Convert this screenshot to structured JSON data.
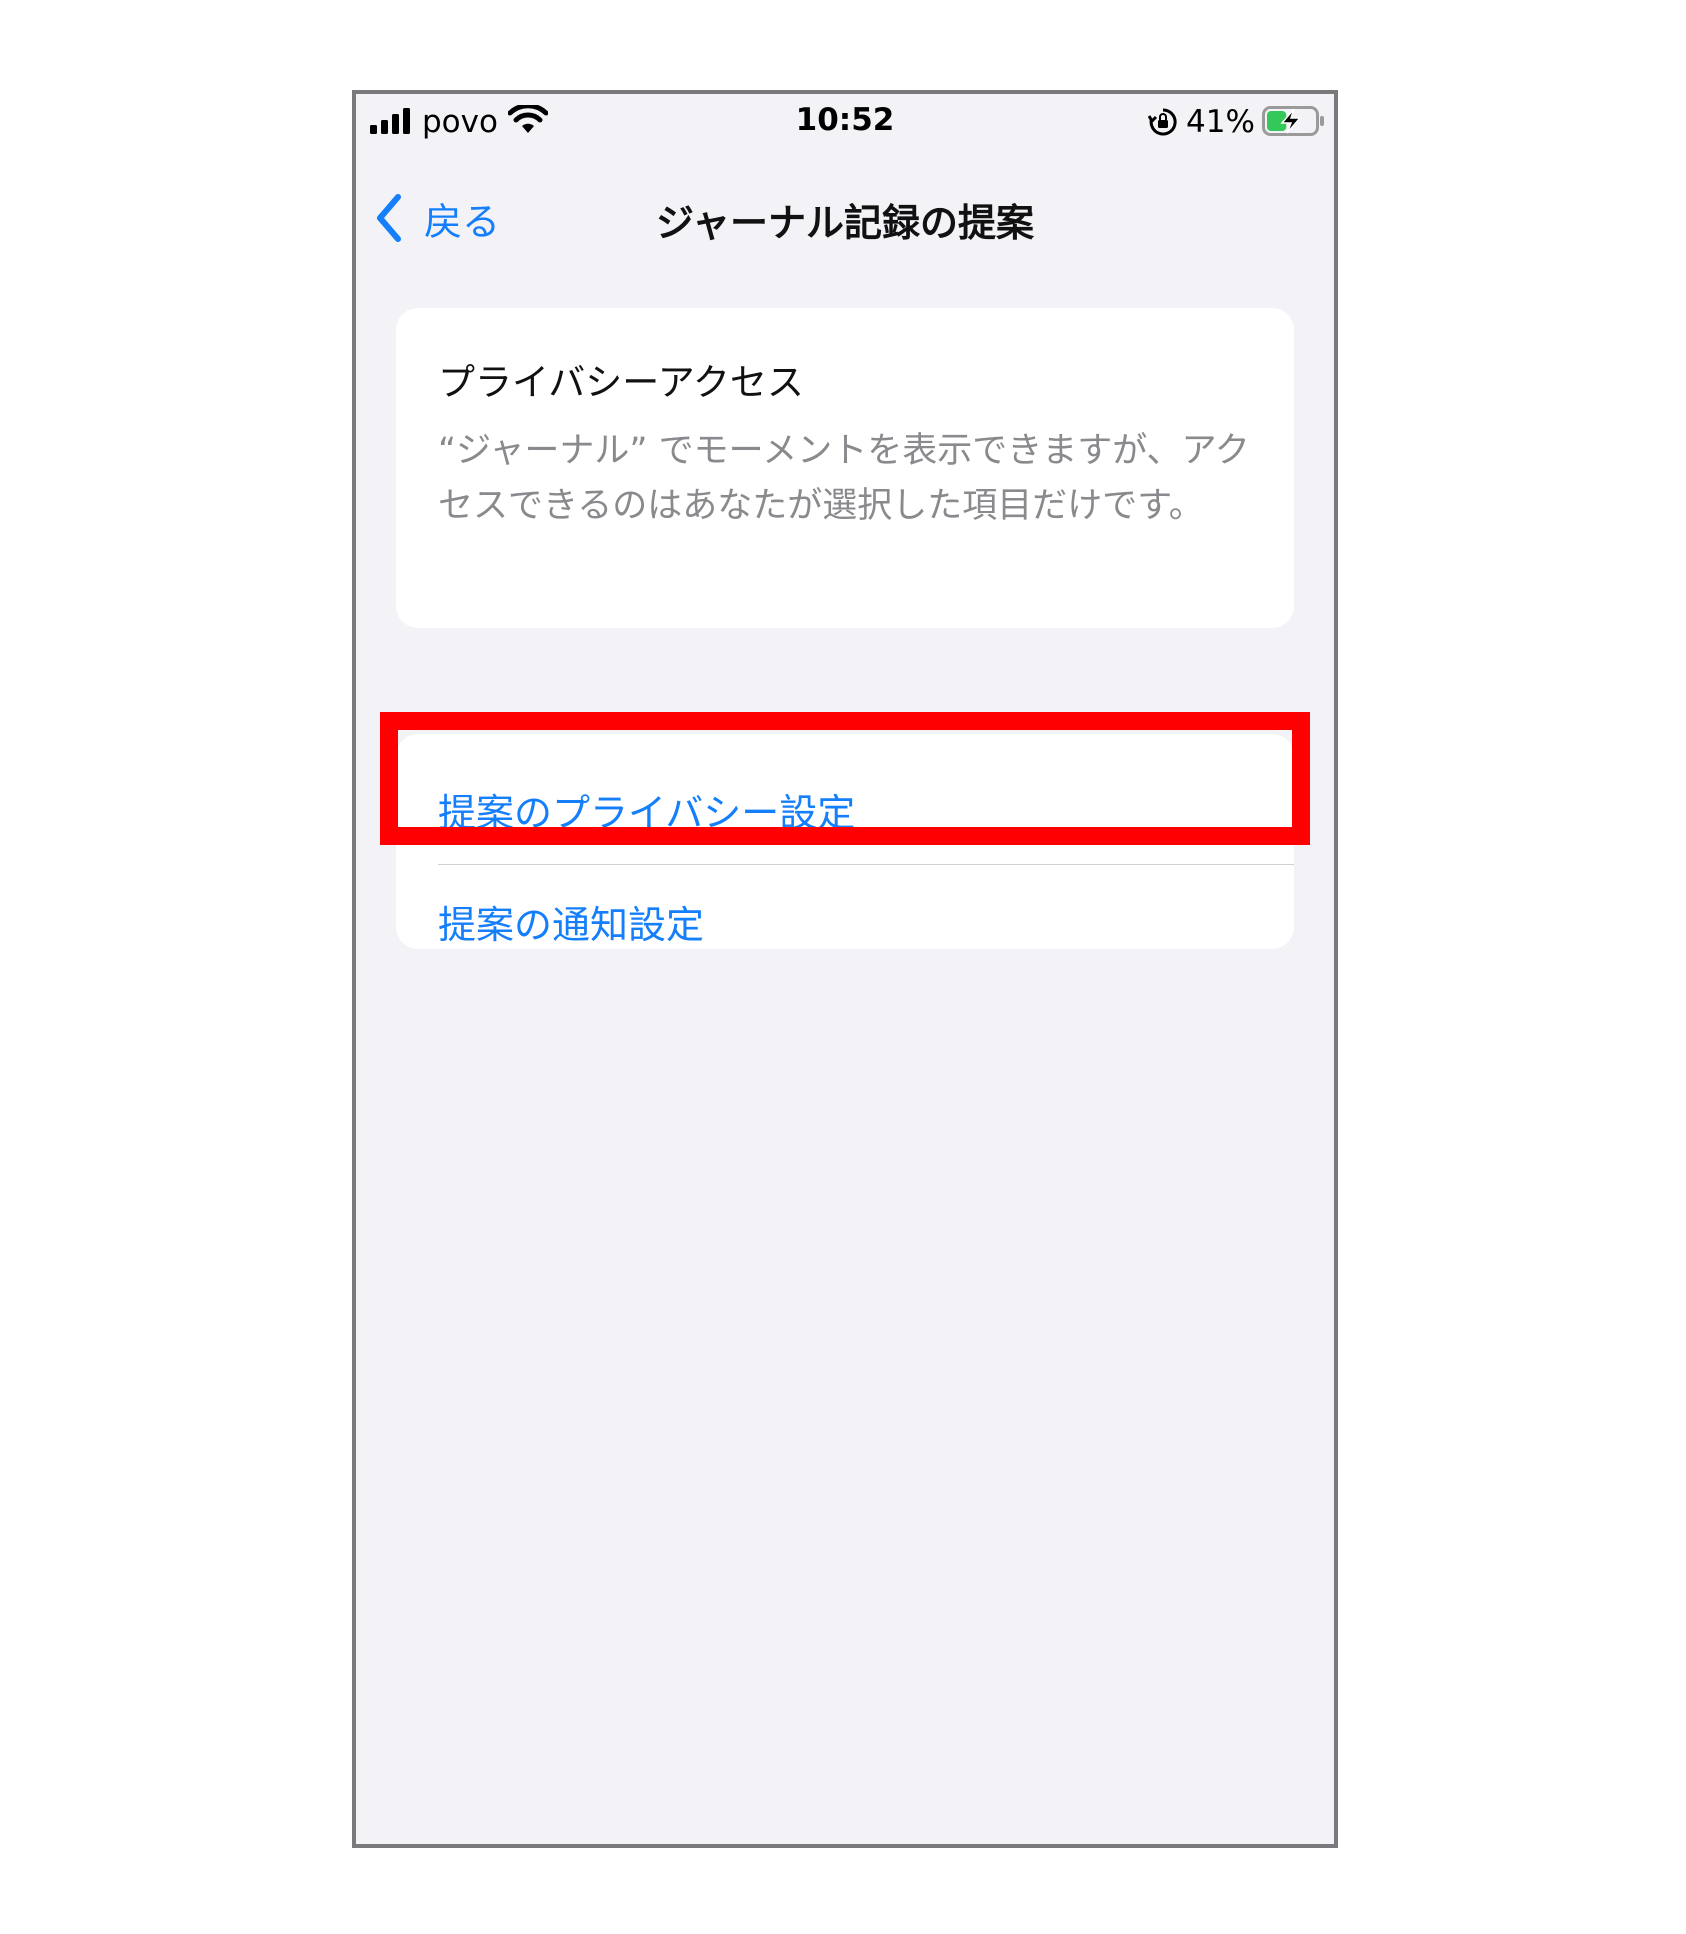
{
  "status_bar": {
    "carrier": "povo",
    "time": "10:52",
    "battery_percent": "41%",
    "battery_level": 0.41,
    "charging": true
  },
  "nav": {
    "back_label": "戻る",
    "title": "ジャーナル記録の提案"
  },
  "privacy_card": {
    "title": "プライバシーアクセス",
    "description": "“ジャーナル” でモーメントを表示できますが、アクセスできるのはあなたが選択した項目だけです。"
  },
  "links": [
    {
      "label": "提案のプライバシー設定",
      "highlighted": true
    },
    {
      "label": "提案の通知設定",
      "highlighted": false
    }
  ],
  "colors": {
    "accent": "#147efb",
    "highlight": "#ff0000",
    "background": "#f2f2f7",
    "battery_fill": "#34c759"
  }
}
